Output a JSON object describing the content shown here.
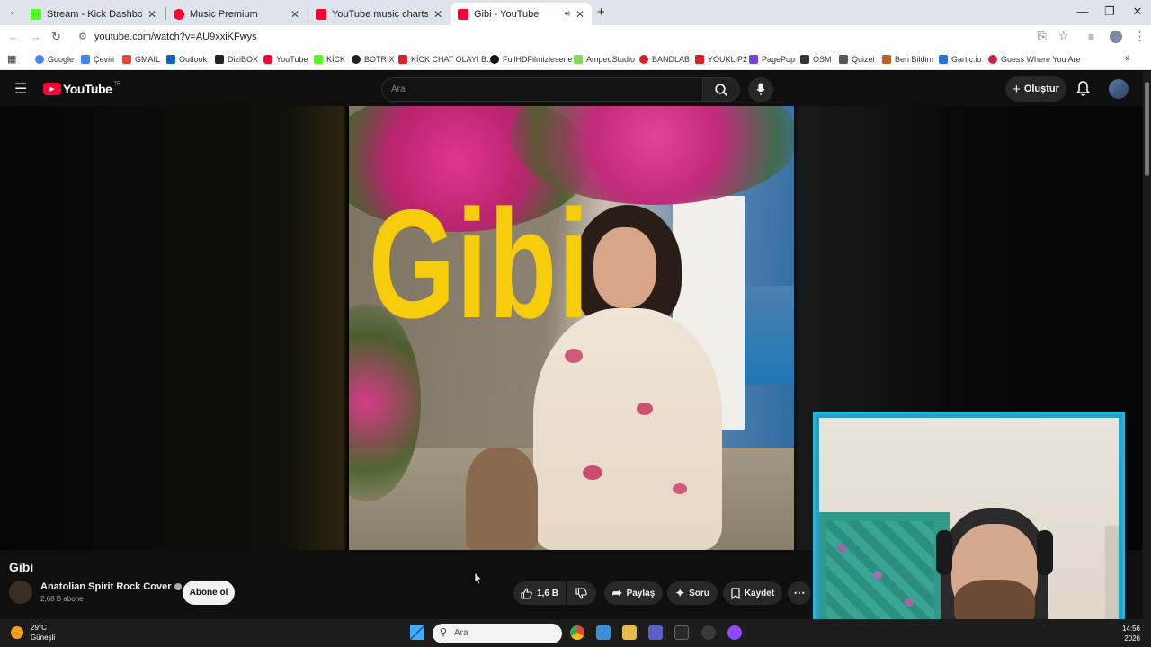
{
  "browser": {
    "tabs": [
      {
        "title": "Stream - Kick Dashboard",
        "favicon_color": "#53fc18"
      },
      {
        "title": "Music Premium",
        "favicon_color": "#ff0033"
      },
      {
        "title": "YouTube music charts: Turkey T",
        "favicon_color": "#ff0033"
      },
      {
        "title": "Gibi - YouTube",
        "favicon_color": "#ff0033"
      }
    ],
    "url": "youtube.com/watch?v=AU9xxiKFwys",
    "bookmarks": [
      {
        "label": "Google",
        "color": "#4285f4"
      },
      {
        "label": "Çeviri",
        "color": "#4285f4"
      },
      {
        "label": "GMAIL",
        "color": "#ea4335"
      },
      {
        "label": "Outlook",
        "color": "#0a64c8"
      },
      {
        "label": "DiziBOX",
        "color": "#222222"
      },
      {
        "label": "YouTube",
        "color": "#ff0033"
      },
      {
        "label": "KİCK",
        "color": "#53fc18"
      },
      {
        "label": "BOTRİX",
        "color": "#222222"
      },
      {
        "label": "KİCK CHAT OLAYI B...",
        "color": "#e02020"
      },
      {
        "label": "FullHDFilmizlesene",
        "color": "#111111"
      },
      {
        "label": "AmpedStudio",
        "color": "#7ed957"
      },
      {
        "label": "BANDLAB",
        "color": "#e02020"
      },
      {
        "label": "YOUKLİP2",
        "color": "#e02020"
      },
      {
        "label": "PagePop",
        "color": "#7b3fe4"
      },
      {
        "label": "OSM",
        "color": "#333333"
      },
      {
        "label": "Quizei",
        "color": "#555555"
      },
      {
        "label": "Ben Bildim",
        "color": "#c06020"
      },
      {
        "label": "Gartic.io",
        "color": "#1e78d8"
      },
      {
        "label": "Guess Where You Are",
        "color": "#d02040"
      }
    ]
  },
  "youtube": {
    "logo_text": "YouTube",
    "logo_region": "TR",
    "search_placeholder": "Ara",
    "create_label": "Oluştur",
    "video_overlay_text": "Gibi",
    "video_title": "Gibi",
    "channel_name": "Anatolian Spirit Rock Cover",
    "subscribers": "2,68 B abone",
    "subscribe_label": "Abone ol",
    "likes": "1,6 B",
    "share_label": "Paylaş",
    "ask_label": "Soru",
    "save_label": "Kaydet",
    "accent": "#ff0033"
  },
  "taskbar": {
    "temperature": "29°C",
    "weather": "Güneşli",
    "search_placeholder": "Ara",
    "time": "14:56",
    "date_fragment": "2026"
  }
}
